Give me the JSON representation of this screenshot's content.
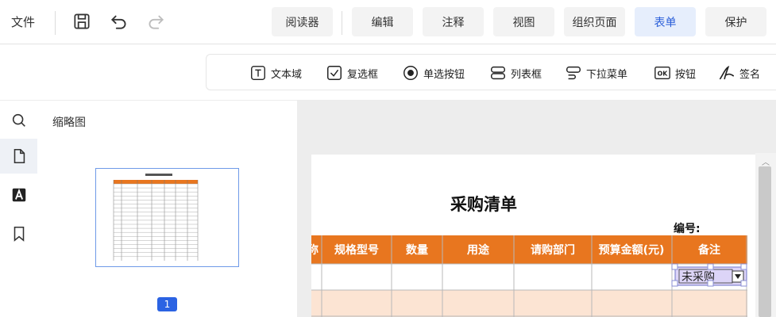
{
  "menubar": {
    "file": "文件",
    "tabs": [
      {
        "label": "阅读器",
        "active": false
      },
      {
        "label": "编辑",
        "active": false
      },
      {
        "label": "注释",
        "active": false
      },
      {
        "label": "视图",
        "active": false
      },
      {
        "label": "组织页面",
        "active": false
      },
      {
        "label": "表单",
        "active": true
      },
      {
        "label": "保护",
        "active": false
      }
    ],
    "icons": [
      "save-icon",
      "undo-icon",
      "redo-icon"
    ]
  },
  "ribbon": {
    "items": [
      {
        "label": "文本域",
        "icon": "text-field-icon"
      },
      {
        "label": "复选框",
        "icon": "checkbox-icon"
      },
      {
        "label": "单选按钮",
        "icon": "radio-button-icon"
      },
      {
        "label": "列表框",
        "icon": "list-box-icon"
      },
      {
        "label": "下拉菜单",
        "icon": "dropdown-icon"
      },
      {
        "label": "按钮",
        "icon": "ok-button-icon"
      },
      {
        "label": "签名",
        "icon": "signature-icon"
      }
    ],
    "ok_glyph": "OK"
  },
  "sidebar": {
    "icons": [
      "search-icon",
      "page-icon",
      "text-annot-icon",
      "bookmark-icon"
    ],
    "panel_title": "缩略图",
    "page_number": "1"
  },
  "document": {
    "title": "采购清单",
    "number_label": "编号:",
    "table_headers": [
      "称",
      "规格型号",
      "数量",
      "用途",
      "请购部门",
      "预算金额(元)",
      "备注"
    ],
    "dropdown_value": "未采购",
    "colors": {
      "header": "#e8761f",
      "stripe": "#fce4d3",
      "accent": "#2b63e3"
    }
  }
}
